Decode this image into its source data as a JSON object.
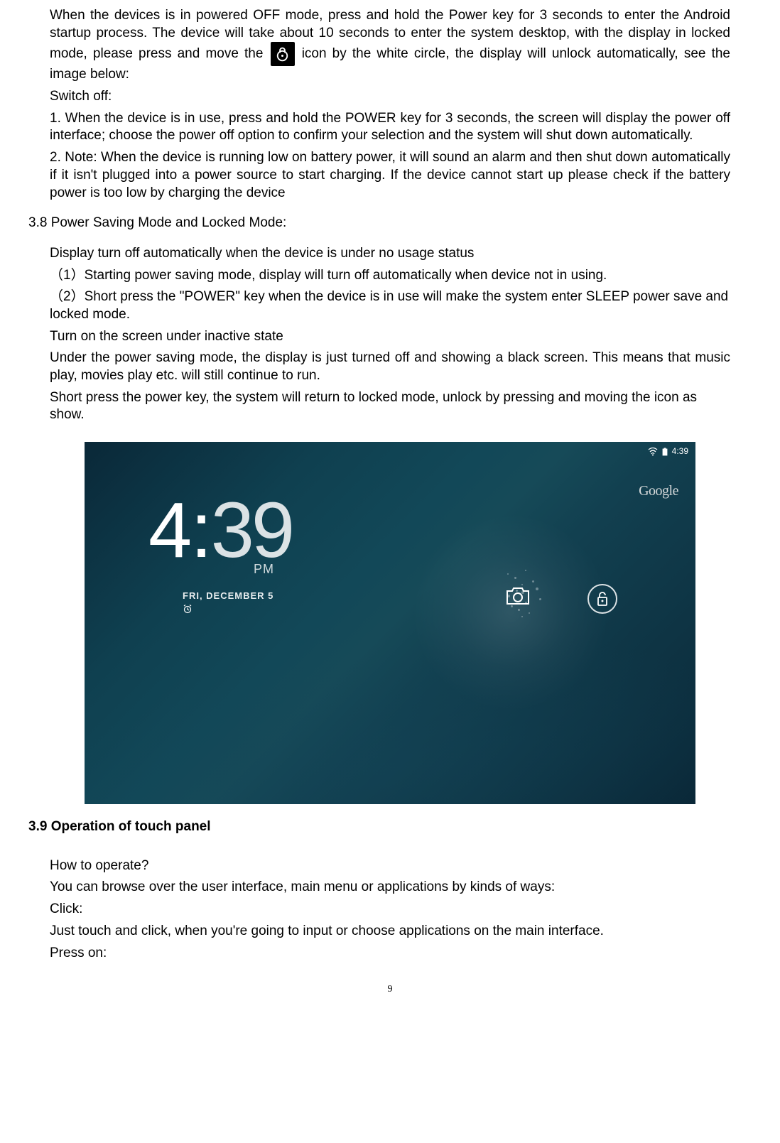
{
  "paragraphs": {
    "p1_part1": "When the devices is in powered OFF mode, press and hold the Power key for 3 seconds to enter the Android startup process. The device will take about 10 seconds to enter the system desktop, with the display in locked mode, please press and move the",
    "p1_part2": "icon by the white circle, the display will unlock automatically, see the image below:",
    "switch_off_label": "Switch off:",
    "p2": "1. When the device is in use, press and hold the POWER key for 3 seconds, the screen will display the power off interface; choose the power off option to confirm your selection and the system will shut down automatically.",
    "p3": "2. Note: When the device is running low on battery power, it will sound an alarm and then shut down automatically if it isn't plugged into a power source to start charging. If the device cannot start up please check if the battery power is too low by charging the device",
    "section_3_8": "3.8 Power Saving Mode and Locked Mode:",
    "p4": "Display turn off automatically when the device is under no usage status",
    "p5": "（1）Starting power saving mode, display will turn off automatically when device not in using.",
    "p6": "（2）Short press the \"POWER\" key when the device is in use will make the system enter SLEEP power save and locked mode.",
    "p7": "Turn on the screen under inactive state",
    "p8": "Under the power saving mode, the display is just turned off and showing a black screen. This means that music play, movies play etc. will still continue to run.",
    "p9": "Short press the power key, the system will return to locked mode, unlock by pressing and moving the icon as show.",
    "section_3_9": "3.9 Operation of touch panel",
    "p10": "How to operate?",
    "p11": "You can browse over the user interface, main menu or applications by kinds of ways:",
    "p12": "Click:",
    "p13": "Just touch and click, when you're going to input or choose applications on the main interface.",
    "p14": "Press on:"
  },
  "lockscreen": {
    "hour": "4",
    "minute": "39",
    "ampm": "PM",
    "date": "FRI, DECEMBER 5",
    "google": "Google",
    "status_time": "4:39"
  },
  "page_number": "9"
}
